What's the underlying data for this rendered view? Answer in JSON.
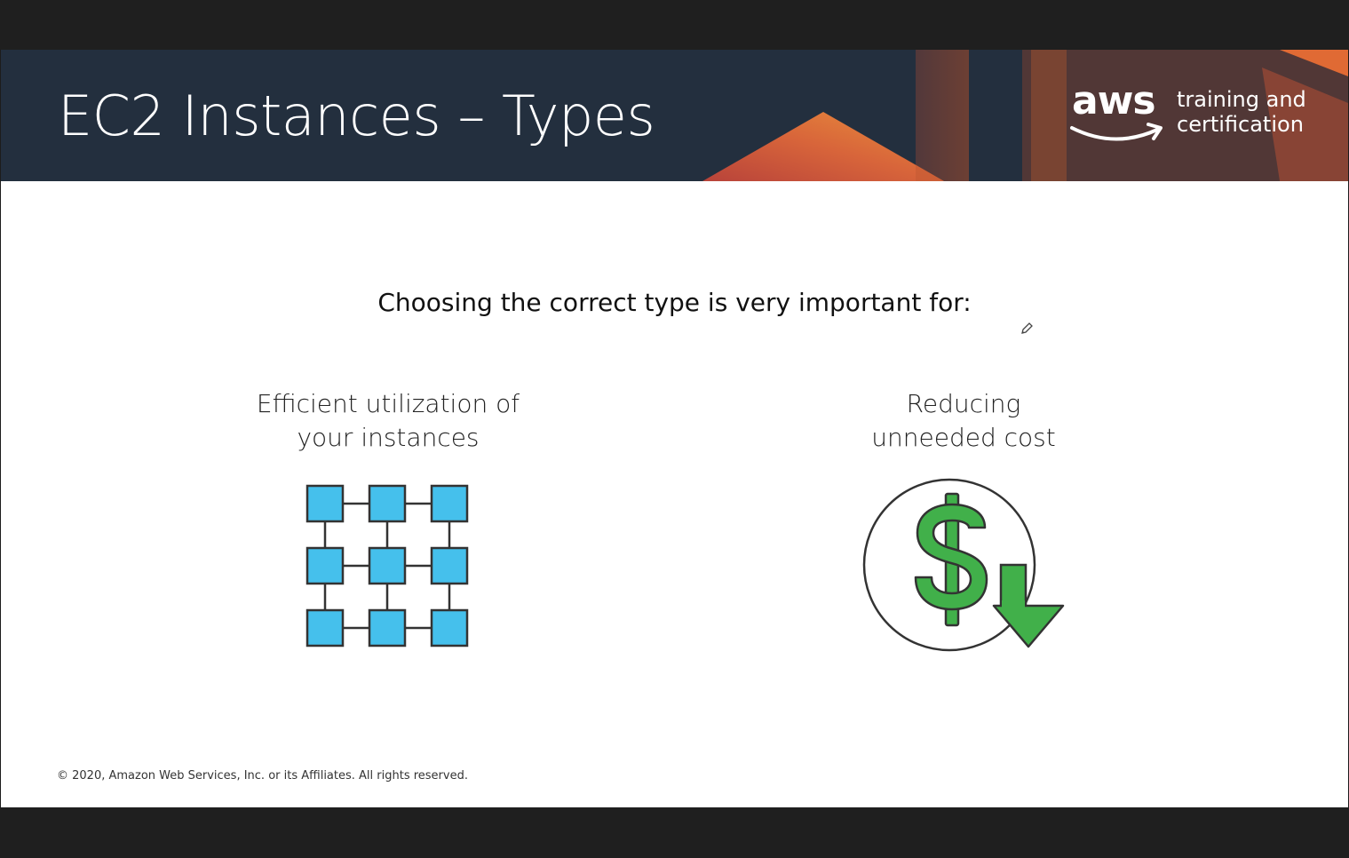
{
  "slide": {
    "title": "EC2 Instances – Types",
    "logo": {
      "wordmark": "aws",
      "tagline_line1": "training and",
      "tagline_line2": "certification"
    },
    "subtitle": "Choosing the correct type is very important for:",
    "items": [
      {
        "line1": "Efficient utilization of",
        "line2": "your instances",
        "icon": "instance-grid-icon"
      },
      {
        "line1": "Reducing",
        "line2": "unneeded cost",
        "icon": "dollar-down-icon"
      }
    ],
    "footer": "© 2020, Amazon Web Services, Inc. or its Affiliates. All rights reserved."
  },
  "colors": {
    "header_bg": "#232f3e",
    "grid_fill": "#45c0ec",
    "cost_green": "#41b04a",
    "accent_orange": "#e2703a"
  }
}
